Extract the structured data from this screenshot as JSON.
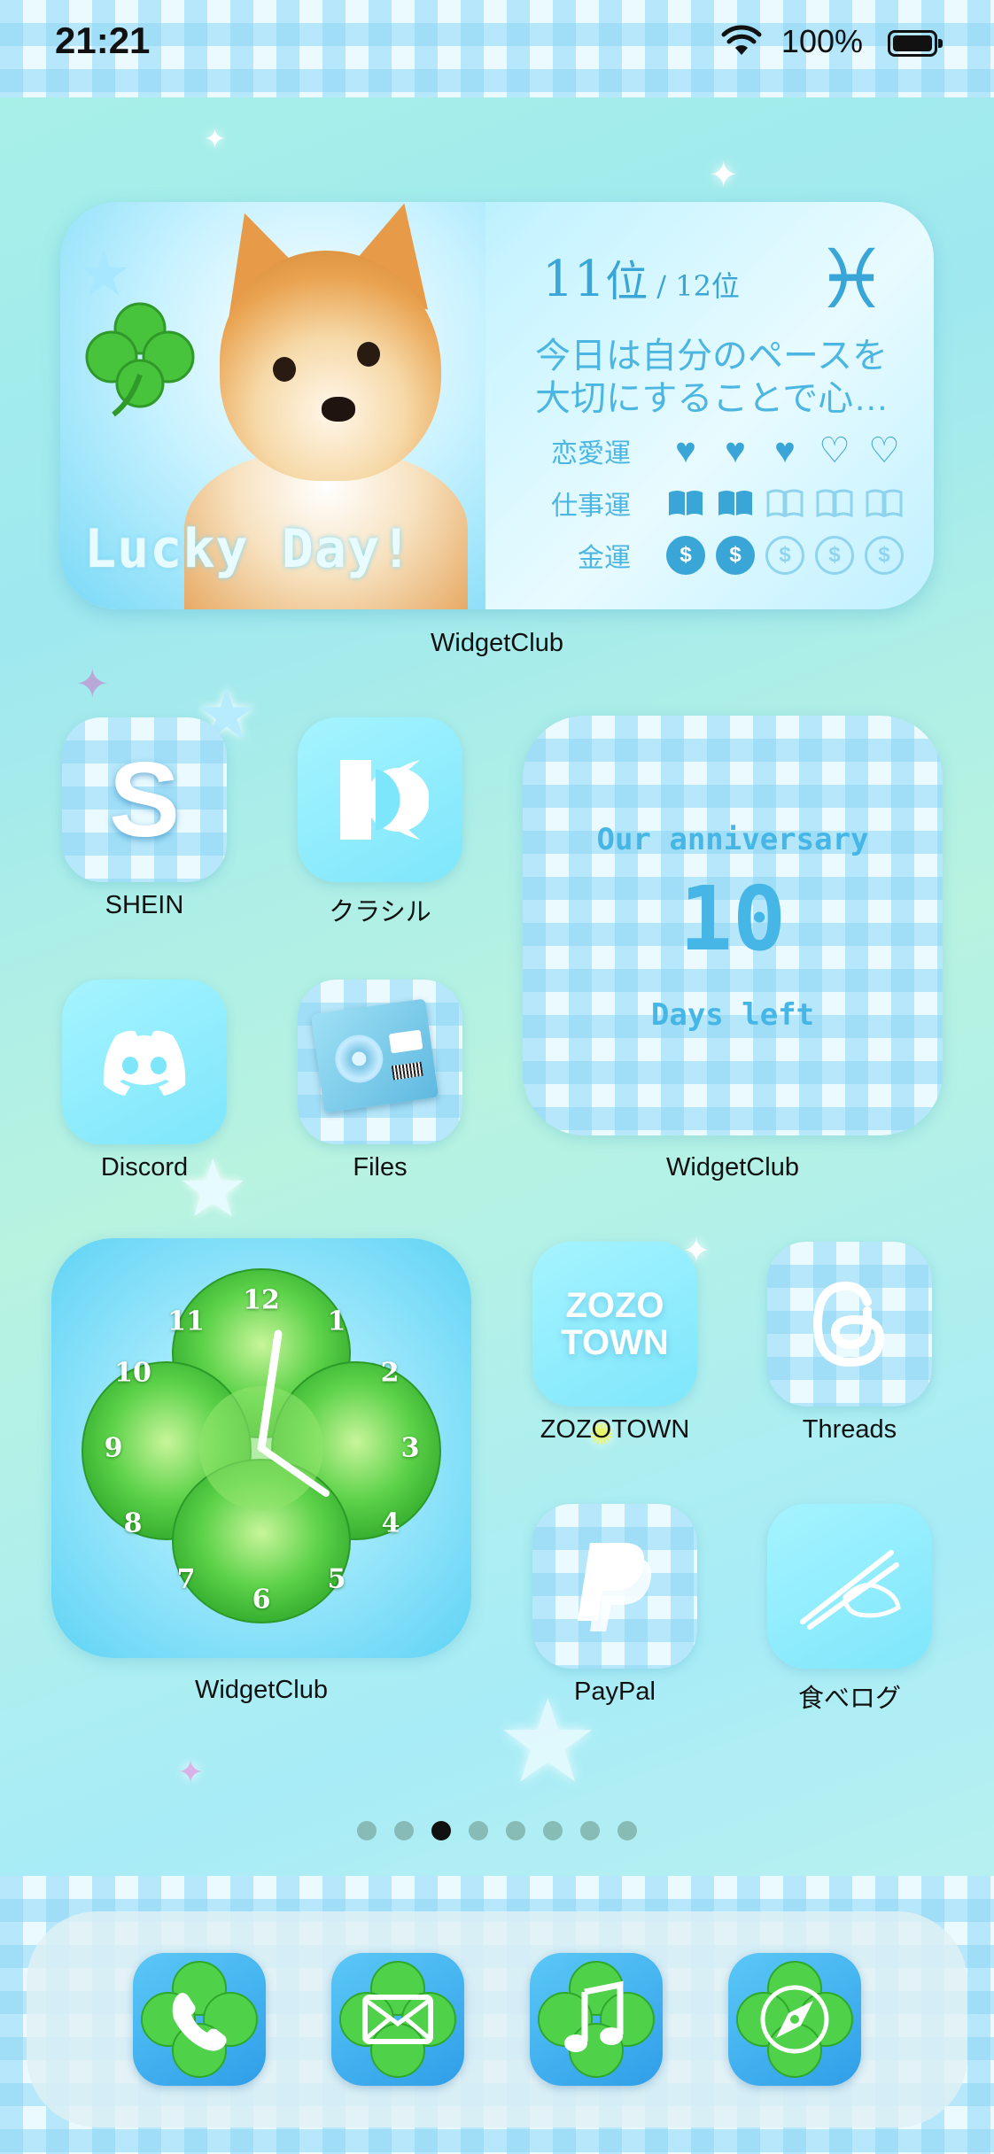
{
  "status_bar": {
    "time": "21:21",
    "battery": "100%"
  },
  "fortune_widget": {
    "banner": "Lucky Day!",
    "rank": "11",
    "rank_unit": "位",
    "rank_total": "/ 12位",
    "zodiac_symbol": "♓",
    "message": "今日は自分のペースを大切にすることで心…",
    "rows": [
      {
        "label": "恋愛運",
        "icon": "heart-icon",
        "filled": 3,
        "total": 5
      },
      {
        "label": "仕事運",
        "icon": "book-icon",
        "filled": 2,
        "total": 5
      },
      {
        "label": "金運",
        "icon": "coin-icon",
        "filled": 2,
        "total": 5
      }
    ],
    "label": "WidgetClub"
  },
  "apps": {
    "shein": {
      "label": "SHEIN",
      "glyph": "S"
    },
    "kurashiru": {
      "label": "クラシル"
    },
    "discord": {
      "label": "Discord"
    },
    "files": {
      "label": "Files"
    },
    "zozotown": {
      "label": "ZOZOTOWN",
      "glyph": "ZOZO TOWN"
    },
    "threads": {
      "label": "Threads"
    },
    "paypal": {
      "label": "PayPal"
    },
    "tabelog": {
      "label": "食べログ"
    }
  },
  "anniversary_widget": {
    "line1": "Our anniversary",
    "days": "10",
    "line2": "Days left",
    "label": "WidgetClub"
  },
  "clock_widget": {
    "numbers": [
      "12",
      "1",
      "2",
      "3",
      "4",
      "5",
      "6",
      "7",
      "8",
      "9",
      "10",
      "11"
    ],
    "label": "WidgetClub"
  },
  "page_dots": {
    "count": 8,
    "active": 2
  },
  "dock": [
    "phone-icon",
    "mail-icon",
    "music-icon",
    "compass-icon"
  ],
  "colors": {
    "accent": "#3aa6d8",
    "icon_bg": "#7ee6fb",
    "clover": "#3ec43a",
    "dock_bg": "#2f9ee8"
  }
}
